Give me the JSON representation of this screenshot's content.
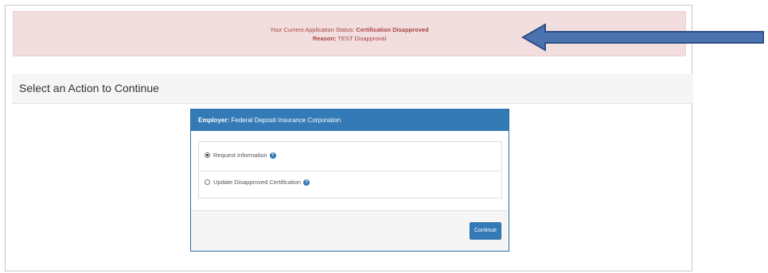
{
  "alert": {
    "status_prefix": "Your Current Application Status:",
    "status_value": "Certification Disapproved",
    "reason_label": "Reason:",
    "reason_value": "TEST Disapproval"
  },
  "section": {
    "title": "Select an Action to Continue"
  },
  "card": {
    "employer_label": "Employer:",
    "employer_name": "Federal Deposit Insurance Corporation",
    "options": [
      {
        "label": "Request Information",
        "selected": true
      },
      {
        "label": "Update Disapproved Certification",
        "selected": false
      }
    ],
    "help_icon": "question-circle-icon",
    "continue_label": "Continue"
  },
  "colors": {
    "alert_bg": "#f2dede",
    "alert_text": "#a94442",
    "primary": "#337ab7",
    "arrow": "#4a73b0"
  }
}
